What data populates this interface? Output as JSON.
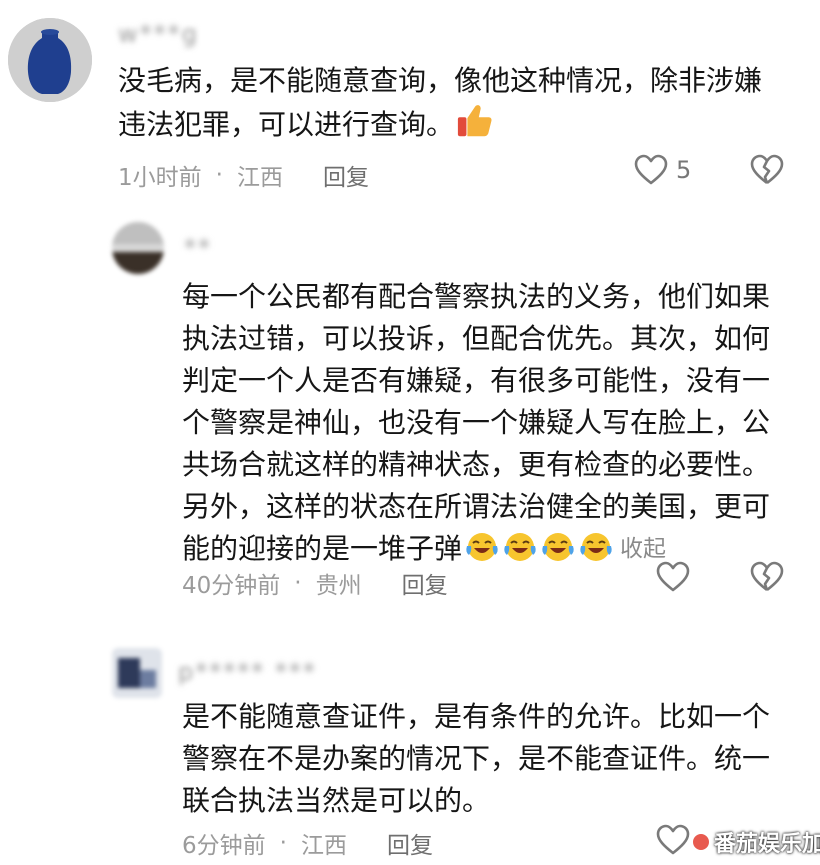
{
  "colors": {
    "text": "#161616",
    "meta": "#9b9b9b",
    "reply": "#6f6f6f",
    "icon": "#7a7a7a",
    "thumb": "#f5b13b"
  },
  "comment1": {
    "username": "w***g",
    "lines": [
      "没毛病，是不能随意查询，像他这种情况，除非涉嫌",
      "违法犯罪，可以进行查询。"
    ],
    "emoji": "thumbs-up",
    "time": "1小时前",
    "location": "江西",
    "reply_label": "回复",
    "like_count": "5"
  },
  "reply1": {
    "username": "**",
    "lines": [
      "每一个公民都有配合警察执法的义务，他们如果",
      "执法过错，可以投诉，但配合优先。其次，如何",
      "判定一个人是否有嫌疑，有很多可能性，没有一",
      "个警察是神仙，也没有一个嫌疑人写在脸上，公",
      "共场合就这样的精神状态，更有检查的必要性。",
      "另外，这样的状态在所谓法治健全的美国，更可",
      "能的迎接的是一堆子弹"
    ],
    "emoji": "laughing-tears",
    "collapse_label": "收起",
    "time": "40分钟前",
    "location": "贵州",
    "reply_label": "回复"
  },
  "reply2": {
    "username": "p***** ***",
    "lines": [
      "是不能随意查证件，是有条件的允许。比如一个",
      "警察在不是办案的情况下，是不能查证件。统一",
      "联合执法当然是可以的。"
    ],
    "time": "6分钟前",
    "location": "江西",
    "reply_label": "回复"
  },
  "watermark": "番茄娱乐加"
}
